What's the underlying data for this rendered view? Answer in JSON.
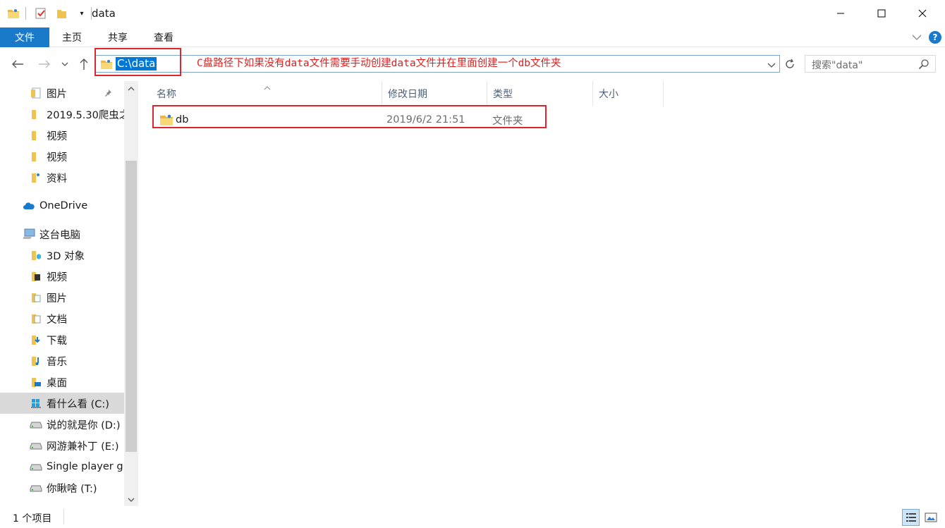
{
  "window": {
    "title": "data",
    "controls": [
      "minimize-icon",
      "maximize-icon",
      "close-icon"
    ]
  },
  "ribbon": {
    "file_tab": "文件",
    "tabs": [
      "主页",
      "共享",
      "查看"
    ]
  },
  "address": {
    "path": "C:\\data",
    "annotation": "C盘路径下如果没有data文件需要手动创建data文件并在里面创建一个db文件夹"
  },
  "search": {
    "placeholder": "搜索\"data\""
  },
  "sidebar": {
    "quick_access": [
      {
        "label": "图片",
        "icon": "pictures-folder-icon",
        "pinned": true
      },
      {
        "label": "2019.5.30爬虫之",
        "icon": "folder-icon"
      },
      {
        "label": "视频",
        "icon": "folder-icon"
      },
      {
        "label": "视频",
        "icon": "folder-icon"
      },
      {
        "label": "资料",
        "icon": "folder-icon"
      }
    ],
    "onedrive": "OneDrive",
    "this_pc": "这台电脑",
    "pc_items": [
      {
        "label": "3D 对象",
        "icon": "3d-objects-icon"
      },
      {
        "label": "视频",
        "icon": "videos-icon"
      },
      {
        "label": "图片",
        "icon": "pictures-icon"
      },
      {
        "label": "文档",
        "icon": "documents-icon"
      },
      {
        "label": "下载",
        "icon": "downloads-icon"
      },
      {
        "label": "音乐",
        "icon": "music-icon"
      },
      {
        "label": "桌面",
        "icon": "desktop-icon"
      },
      {
        "label": "看什么看 (C:)",
        "icon": "windows-drive-icon",
        "selected": true
      },
      {
        "label": "说的就是你 (D:)",
        "icon": "drive-icon"
      },
      {
        "label": "网游兼补丁 (E:)",
        "icon": "drive-icon"
      },
      {
        "label": "Single player g",
        "icon": "drive-icon"
      },
      {
        "label": "你瞅啥 (T:)",
        "icon": "drive-icon"
      }
    ]
  },
  "filelist": {
    "columns": [
      "名称",
      "修改日期",
      "类型",
      "大小"
    ],
    "rows": [
      {
        "name": "db",
        "modified": "2019/6/2 21:51",
        "type": "文件夹",
        "size": ""
      }
    ]
  },
  "status": {
    "item_count": "1 个项目"
  },
  "colors": {
    "accent": "#1979ca",
    "annotation_red": "#e0242c",
    "selection_blue": "#0078d7"
  }
}
